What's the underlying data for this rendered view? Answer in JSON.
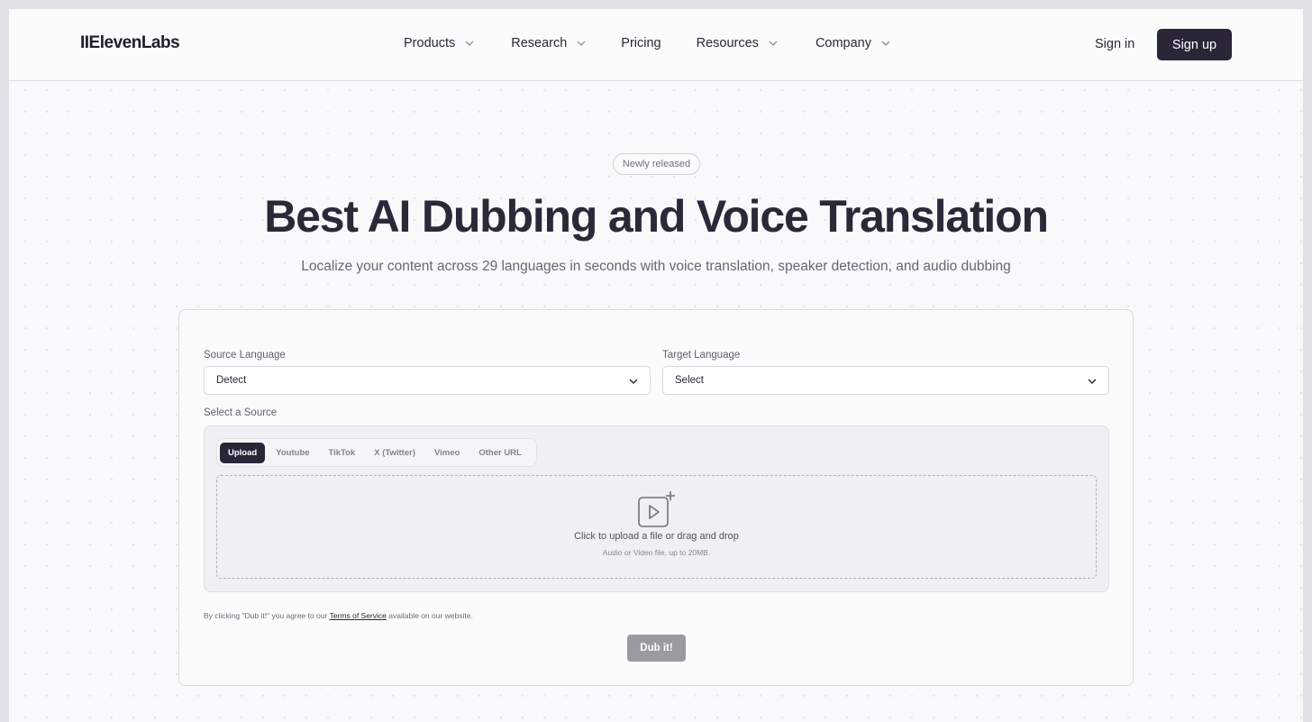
{
  "header": {
    "logo": "IIElevenLabs",
    "nav": [
      {
        "label": "Products",
        "has_dropdown": true
      },
      {
        "label": "Research",
        "has_dropdown": true
      },
      {
        "label": "Pricing",
        "has_dropdown": false
      },
      {
        "label": "Resources",
        "has_dropdown": true
      },
      {
        "label": "Company",
        "has_dropdown": true
      }
    ],
    "sign_in": "Sign in",
    "sign_up": "Sign up"
  },
  "hero": {
    "badge": "Newly released",
    "title": "Best AI Dubbing and Voice Translation",
    "subtitle": "Localize your content across 29 languages in seconds with voice translation, speaker detection, and audio dubbing"
  },
  "form": {
    "source_language": {
      "label": "Source Language",
      "value": "Detect"
    },
    "target_language": {
      "label": "Target Language",
      "value": "Select"
    },
    "source_label": "Select a Source",
    "tabs": [
      {
        "label": "Upload",
        "active": true
      },
      {
        "label": "Youtube",
        "active": false
      },
      {
        "label": "TikTok",
        "active": false
      },
      {
        "label": "X (Twitter)",
        "active": false
      },
      {
        "label": "Vimeo",
        "active": false
      },
      {
        "label": "Other URL",
        "active": false
      }
    ],
    "dropzone": {
      "icon": "video-upload-icon",
      "text": "Click to upload a file or drag and drop",
      "hint": "Audio or Video file, up to 20MB."
    },
    "terms": {
      "prefix": "By clicking \"Dub it!\" you agree to our",
      "link": "Terms of Service",
      "suffix": "available on our website."
    },
    "submit": "Dub it!"
  },
  "colors": {
    "primary": "#2a2638",
    "disabled_button": "#9a9aa2",
    "background": "#f8f9fa"
  }
}
